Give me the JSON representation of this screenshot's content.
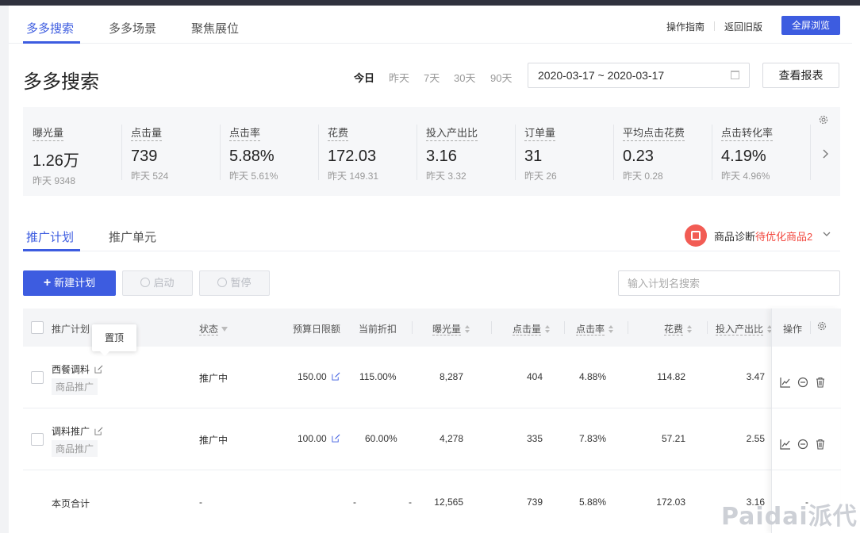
{
  "topnav": {
    "tabs": [
      "多多搜索",
      "多多场景",
      "聚焦展位"
    ],
    "guide_link": "操作指南",
    "old_version_link": "返回旧版",
    "fullscreen_button": "全屏浏览"
  },
  "header": {
    "title": "多多搜索",
    "ranges": [
      "今日",
      "昨天",
      "7天",
      "30天",
      "90天"
    ],
    "date_range": "2020-03-17 ~ 2020-03-17",
    "report_button": "查看报表"
  },
  "metrics": [
    {
      "label": "曝光量",
      "value": "1.26万",
      "yesterday": "昨天 9348"
    },
    {
      "label": "点击量",
      "value": "739",
      "yesterday": "昨天 524"
    },
    {
      "label": "点击率",
      "value": "5.88%",
      "yesterday": "昨天 5.61%"
    },
    {
      "label": "花费",
      "value": "172.03",
      "yesterday": "昨天 149.31"
    },
    {
      "label": "投入产出比",
      "value": "3.16",
      "yesterday": "昨天 3.32"
    },
    {
      "label": "订单量",
      "value": "31",
      "yesterday": "昨天 26"
    },
    {
      "label": "平均点击花费",
      "value": "0.23",
      "yesterday": "昨天 0.28"
    },
    {
      "label": "点击转化率",
      "value": "4.19%",
      "yesterday": "昨天 4.96%"
    }
  ],
  "subtabs": [
    "推广计划",
    "推广单元"
  ],
  "diagnosis": {
    "label": "商品诊断",
    "warning": "待优化商品2"
  },
  "actions": {
    "new_plan": "新建计划",
    "start": "启动",
    "pause": "暂停",
    "search_placeholder": "输入计划名搜索"
  },
  "table": {
    "columns": {
      "plan": "推广计划",
      "status": "状态",
      "budget": "预算日限额",
      "discount": "当前折扣",
      "impressions": "曝光量",
      "clicks": "点击量",
      "ctr": "点击率",
      "cost": "花费",
      "roi": "投入产出比",
      "ops": "操作"
    },
    "tooltip": "置顶",
    "rows": [
      {
        "name": "西餐调料",
        "tag": "商品推广",
        "status": "推广中",
        "budget": "150.00",
        "discount": "115.00%",
        "impressions": "8,287",
        "clicks": "404",
        "ctr": "4.88%",
        "cost": "114.82",
        "roi": "3.47"
      },
      {
        "name": "调料推广",
        "tag": "商品推广",
        "status": "推广中",
        "budget": "100.00",
        "discount": "60.00%",
        "impressions": "4,278",
        "clicks": "335",
        "ctr": "7.83%",
        "cost": "57.21",
        "roi": "2.55"
      }
    ],
    "total": {
      "label": "本页合计",
      "status": "-",
      "budget": "-",
      "discount": "-",
      "impressions": "12,565",
      "clicks": "739",
      "ctr": "5.88%",
      "cost": "172.03",
      "roi": "3.16",
      "ops": "-"
    }
  },
  "watermark": "Paidai派代",
  "colors": {
    "accent": "#3d5ce0",
    "warning": "#f2483f"
  }
}
